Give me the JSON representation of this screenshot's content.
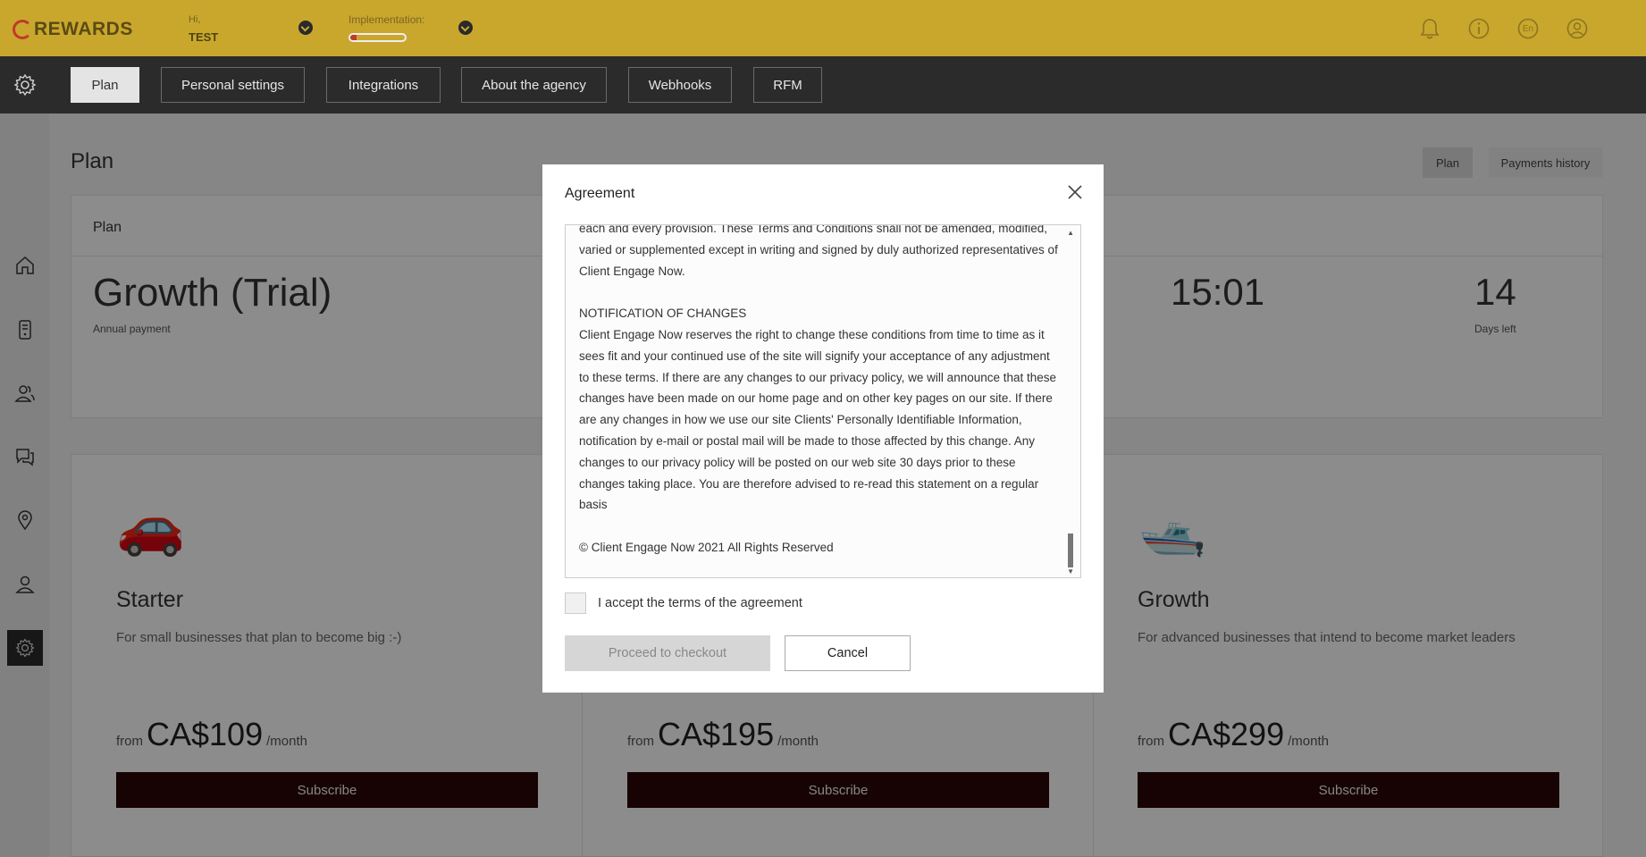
{
  "header": {
    "logo_text": "REWARDS",
    "greeting": "Hi,",
    "user": "TEST",
    "implementation_label": "Implementation:",
    "implementation_progress": 0.12,
    "icons": [
      "bell-icon",
      "info-icon",
      "language-icon",
      "user-circle-icon"
    ],
    "language": "En"
  },
  "nav": {
    "tabs": [
      {
        "label": "Plan",
        "active": true
      },
      {
        "label": "Personal settings",
        "active": false
      },
      {
        "label": "Integrations",
        "active": false
      },
      {
        "label": "About the agency",
        "active": false
      },
      {
        "label": "Webhooks",
        "active": false
      },
      {
        "label": "RFM",
        "active": false
      }
    ]
  },
  "sidebar": {
    "items": [
      "home-icon",
      "device-icon",
      "users-icon",
      "chat-icon",
      "location-icon",
      "profile-icon",
      "gear-icon"
    ],
    "active": "gear-icon"
  },
  "main": {
    "title": "Plan",
    "segments": [
      {
        "label": "Plan"
      },
      {
        "label": "Payments history"
      }
    ],
    "plan_card": {
      "heading": "Plan",
      "plan_name": "Growth (Trial)",
      "billing": "Annual payment",
      "timer": "15:01",
      "days_left_value": "14",
      "days_left_label": "Days left"
    },
    "tiers": [
      {
        "emoji": "🚗",
        "name": "Starter",
        "description": "For small businesses that plan to become big :-)",
        "from": "from",
        "price": "CA$109",
        "per": "/month",
        "button": "Subscribe"
      },
      {
        "emoji": "",
        "name": "",
        "description": "",
        "from": "from",
        "price": "CA$195",
        "per": "/month",
        "button": "Subscribe"
      },
      {
        "emoji": "🛥️",
        "name": "Growth",
        "description": "For advanced businesses that intend to become market leaders",
        "from": "from",
        "price": "CA$299",
        "per": "/month",
        "button": "Subscribe"
      }
    ]
  },
  "modal": {
    "title": "Agreement",
    "terms": [
      "each and every provision. These Terms and Conditions shall not be amended, modified, varied or supplemented except in writing and signed by duly authorized representatives of Client Engage Now.",
      "NOTIFICATION OF CHANGES",
      "Client Engage Now reserves the right to change these conditions from time to time as it sees fit and your continued use of the site will signify your acceptance of any adjustment to these terms. If there are any changes to our privacy policy, we will announce that these changes have been made on our home page and on other key pages on our site. If there are any changes in how we use our site Clients' Personally Identifiable Information, notification by e-mail or postal mail will be made to those affected by this change. Any changes to our privacy policy will be posted on our web site 30 days prior to these changes taking place. You are therefore advised to re-read this statement on a regular basis",
      "© Client Engage Now 2021 All Rights Reserved"
    ],
    "accept_label": "I accept the terms of the agreement",
    "accepted": false,
    "proceed_label": "Proceed to checkout",
    "cancel_label": "Cancel"
  }
}
